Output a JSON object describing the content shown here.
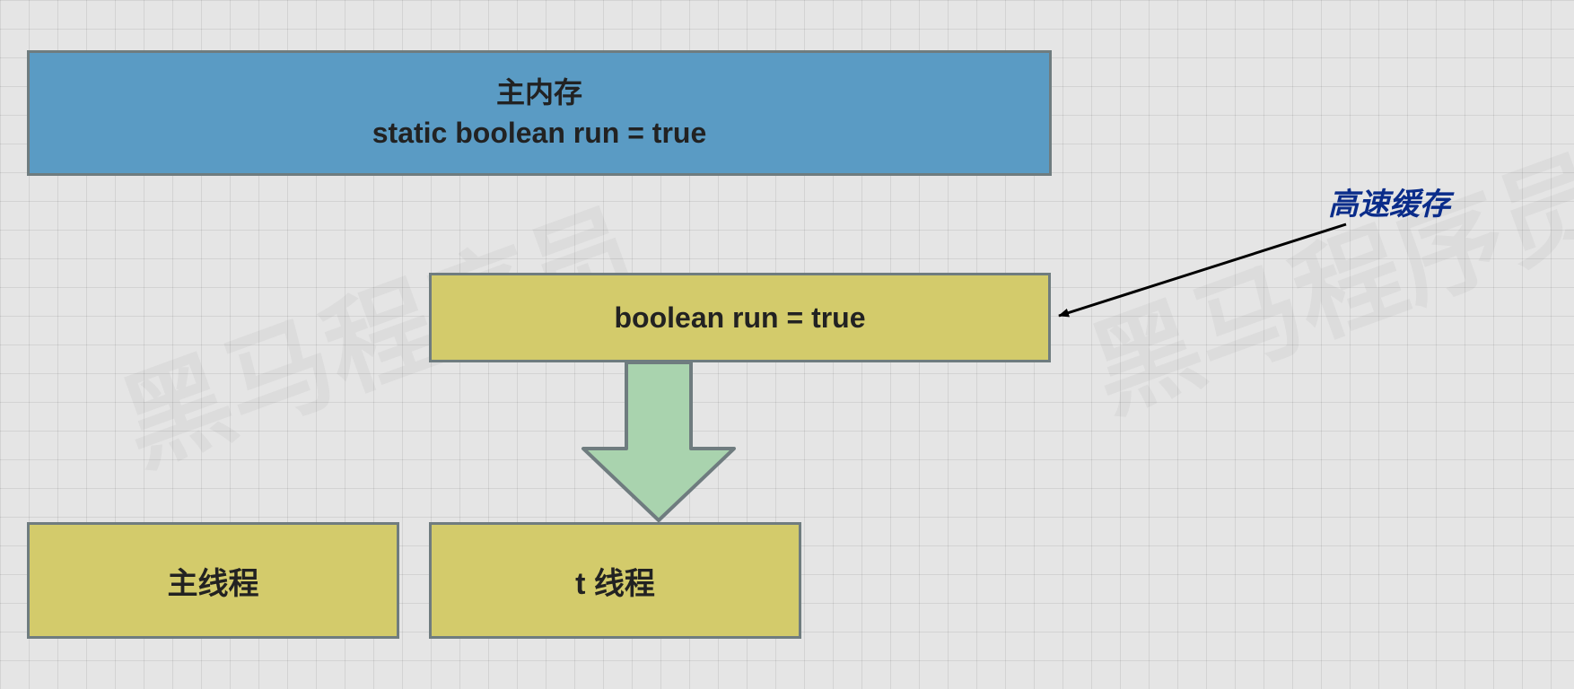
{
  "main_memory": {
    "title": "主内存",
    "code": "static boolean run = true"
  },
  "cache": {
    "code": "boolean run = true"
  },
  "threads": {
    "main": "主线程",
    "t": "t 线程"
  },
  "annotation": {
    "cache_label": "高速缓存"
  },
  "colors": {
    "grid_bg": "#e5e5e5",
    "memory_box": "#5a9bc4",
    "thread_box": "#d3cb6b",
    "border": "#6f7c7f",
    "arrow_fill": "#a9d3ae",
    "arrow_border": "#6f7c7f",
    "annotation_text": "#0a2c8a"
  }
}
